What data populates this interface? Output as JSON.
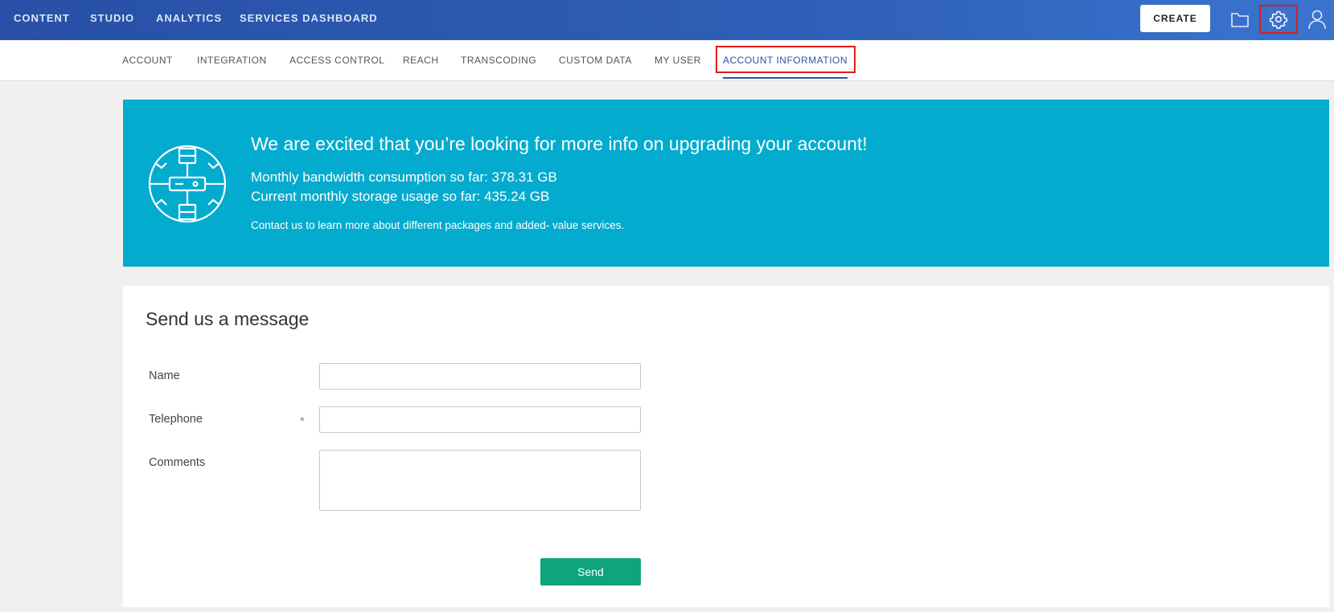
{
  "topnav": {
    "links": [
      "CONTENT",
      "STUDIO",
      "ANALYTICS",
      "SERVICES DASHBOARD"
    ],
    "create_label": "CREATE",
    "icons": [
      "folder-icon",
      "gear-icon",
      "user-icon"
    ]
  },
  "subnav": {
    "tabs": [
      "ACCOUNT",
      "INTEGRATION",
      "ACCESS CONTROL",
      "REACH",
      "TRANSCODING",
      "CUSTOM DATA",
      "MY USER",
      "ACCOUNT INFORMATION"
    ],
    "active_tab": "ACCOUNT INFORMATION"
  },
  "banner": {
    "title": "We are excited that you’re looking for more info on upgrading your account!",
    "bandwidth": "Monthly bandwidth consumption so far: 378.31 GB",
    "storage": "Current monthly storage usage so far: 435.24 GB",
    "note": "Contact us to learn more about different packages and added- value services.",
    "icon": "server-network-icon"
  },
  "form": {
    "title": "Send us a message",
    "name_label": "Name",
    "name_value": "",
    "telephone_label": "Telephone",
    "telephone_value": "",
    "required_mark": "*",
    "comments_label": "Comments",
    "comments_value": "",
    "send_label": "Send"
  },
  "colors": {
    "topnav": "#2f5fb6",
    "banner": "#03abce",
    "send_button": "#0ea57e",
    "active_tab": "#2b55a3",
    "highlight": "#e01b1b"
  }
}
